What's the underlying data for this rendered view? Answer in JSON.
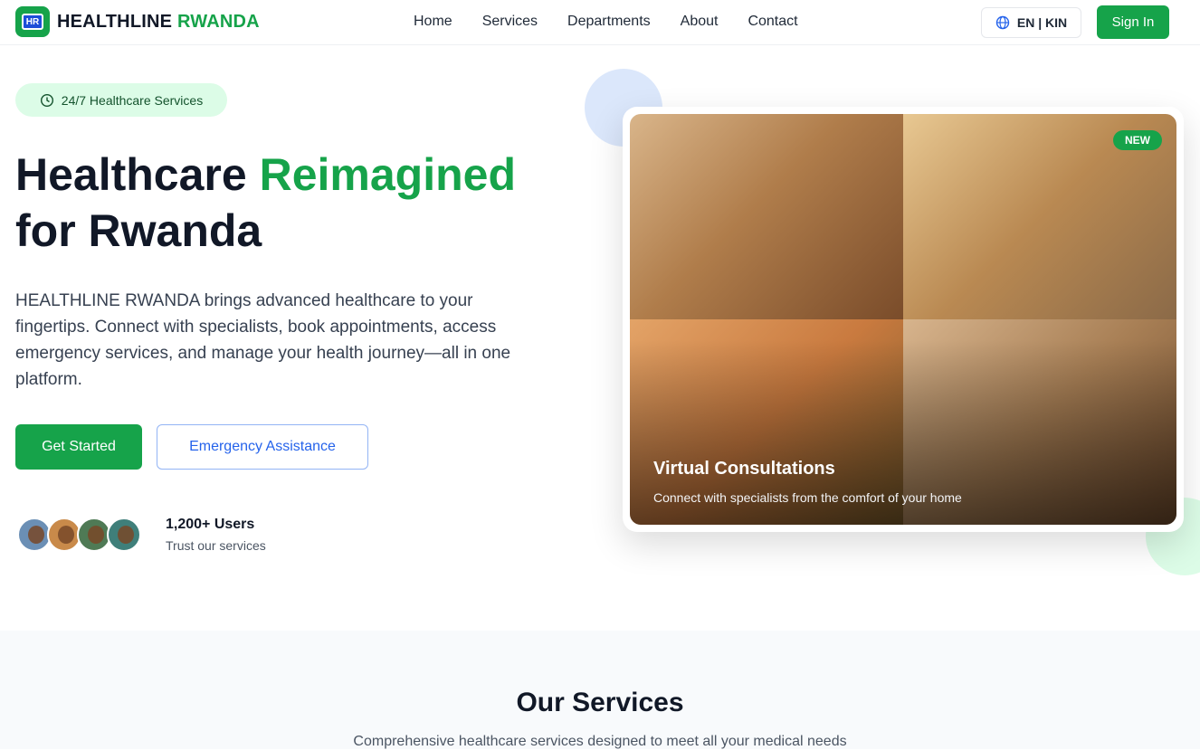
{
  "navbar": {
    "logo_mark": "HR",
    "logo_text_main": "HEALTHLINE",
    "logo_text_accent": "RWANDA",
    "links": [
      "Home",
      "Services",
      "Departments",
      "About",
      "Contact"
    ],
    "language_label": "EN | KIN",
    "signin_label": "Sign In"
  },
  "hero": {
    "badge_text": "24/7 Healthcare Services",
    "title_part1": "Healthcare",
    "title_accent": "Reimagined",
    "title_part2": "for Rwanda",
    "description": "HEALTHLINE RWANDA brings advanced healthcare to your fingertips. Connect with specialists, book appointments, access emergency services, and manage your health journey—all in one platform.",
    "primary_button": "Get Started",
    "secondary_button": "Emergency Assistance",
    "users_count": "1,200+ Users",
    "users_subtitle": "Trust our services"
  },
  "image_card": {
    "badge": "NEW",
    "title": "Virtual Consultations",
    "subtitle": "Connect with specialists from the comfort of your home"
  },
  "services": {
    "title": "Our Services",
    "subtitle": "Comprehensive healthcare services designed to meet all your medical needs"
  },
  "colors": {
    "brand_green": "#16a34a",
    "accent_blue": "#2563eb",
    "light_green": "#dcfce7"
  },
  "icons": {
    "logo": "hr-logo-icon",
    "language": "globe-icon",
    "badge": "clock-icon"
  }
}
